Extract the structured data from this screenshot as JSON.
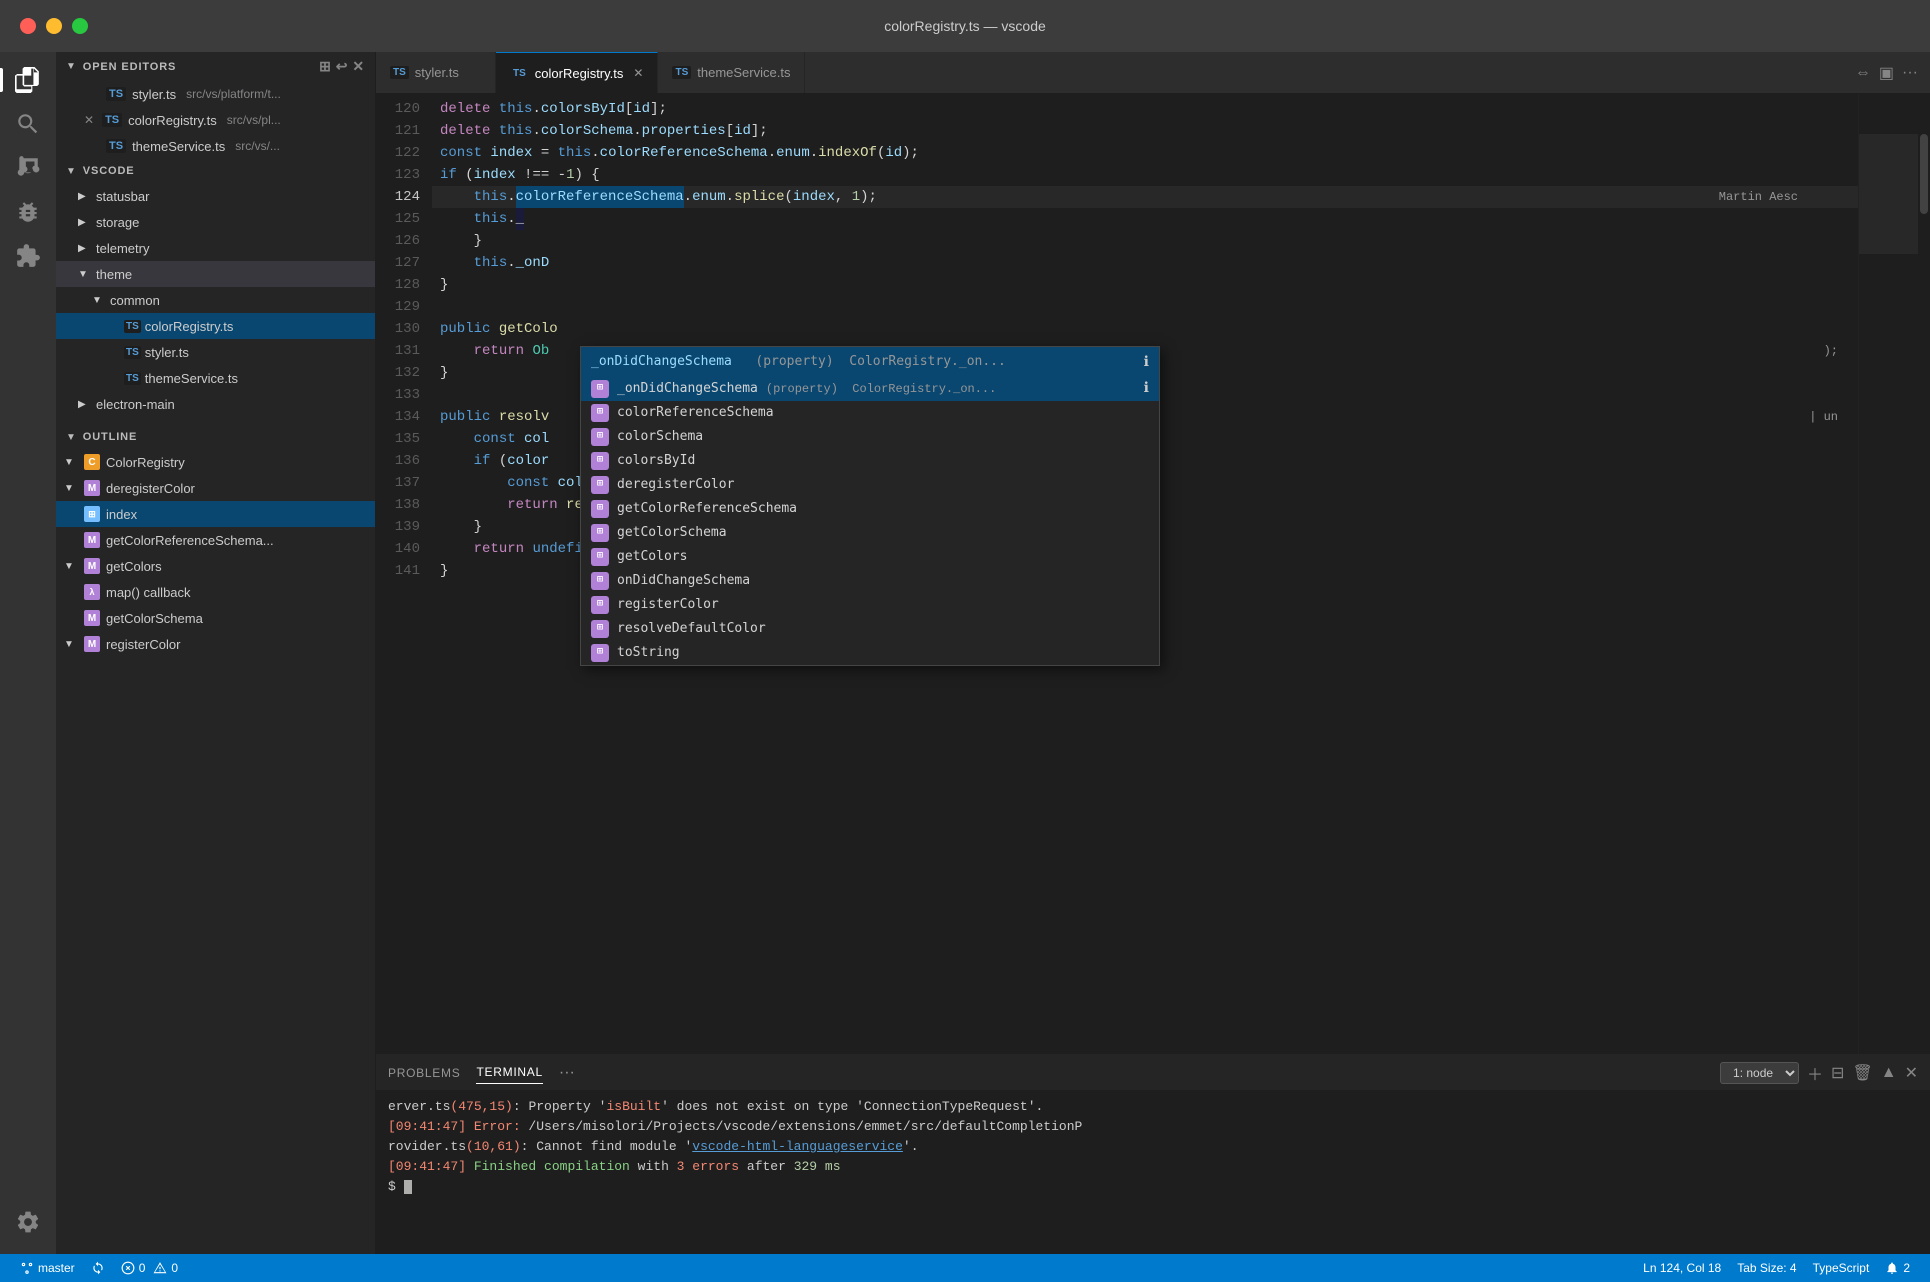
{
  "titlebar": {
    "title": "colorRegistry.ts — vscode"
  },
  "tabs": [
    {
      "id": "styler",
      "icon": "TS",
      "label": "styler.ts",
      "active": false,
      "closeable": false
    },
    {
      "id": "colorRegistry",
      "icon": "TS",
      "label": "colorRegistry.ts",
      "active": true,
      "closeable": true
    },
    {
      "id": "themeService",
      "icon": "TS",
      "label": "themeService.ts",
      "active": false,
      "closeable": false
    }
  ],
  "sidebar": {
    "open_editors_label": "OPEN EDITORS",
    "vscode_label": "VSCODE",
    "outline_label": "OUTLINE",
    "open_files": [
      {
        "icon": "TS",
        "name": "styler.ts",
        "path": "src/vs/platform/t..."
      },
      {
        "icon": "TS",
        "name": "colorRegistry.ts",
        "path": "src/vs/pl...",
        "active": true,
        "close": true
      },
      {
        "icon": "TS",
        "name": "themeService.ts",
        "path": "src/vs/..."
      }
    ],
    "tree": [
      {
        "indent": 1,
        "chevron": "▶",
        "label": "statusbar"
      },
      {
        "indent": 1,
        "chevron": "▶",
        "label": "storage"
      },
      {
        "indent": 1,
        "chevron": "▶",
        "label": "telemetry"
      },
      {
        "indent": 1,
        "chevron": "▼",
        "label": "theme",
        "active": true
      },
      {
        "indent": 2,
        "chevron": "▼",
        "label": "common"
      },
      {
        "indent": 3,
        "chevron": "",
        "label": "colorRegistry.ts",
        "file": true,
        "selected": true
      },
      {
        "indent": 3,
        "chevron": "",
        "label": "styler.ts",
        "file": true
      },
      {
        "indent": 3,
        "chevron": "",
        "label": "themeService.ts",
        "file": true
      },
      {
        "indent": 1,
        "chevron": "▶",
        "label": "electron-main"
      }
    ],
    "outline": [
      {
        "indent": 1,
        "chevron": "▼",
        "icon": "class",
        "label": "ColorRegistry"
      },
      {
        "indent": 2,
        "chevron": "▼",
        "icon": "method",
        "label": "deregisterColor"
      },
      {
        "indent": 3,
        "chevron": "",
        "icon": "field",
        "label": "index"
      },
      {
        "indent": 2,
        "chevron": "",
        "icon": "method",
        "label": "getColorReferenceSchema..."
      },
      {
        "indent": 2,
        "chevron": "▼",
        "icon": "method",
        "label": "getColors"
      },
      {
        "indent": 3,
        "chevron": "",
        "icon": "field",
        "label": "map() callback"
      },
      {
        "indent": 3,
        "chevron": "",
        "icon": "field",
        "label": "getColorSchema"
      },
      {
        "indent": 2,
        "chevron": "▼",
        "icon": "method",
        "label": "registerColor"
      }
    ]
  },
  "code": {
    "lines": [
      {
        "num": 120,
        "content": "        delete this.colorsById[id];"
      },
      {
        "num": 121,
        "content": "        delete this.colorSchema.properties[id];"
      },
      {
        "num": 122,
        "content": "        const index = this.colorReferenceSchema.enum.indexOf(id);"
      },
      {
        "num": 123,
        "content": "        if (index !== -1) {"
      },
      {
        "num": 124,
        "content": "            this.colorReferenceSchema.enum.splice(index, 1);",
        "highlight": true
      },
      {
        "num": 125,
        "content": "            this._"
      },
      {
        "num": 126,
        "content": "        }"
      },
      {
        "num": 127,
        "content": "        this._onD"
      },
      {
        "num": 128,
        "content": "    }"
      },
      {
        "num": 129,
        "content": ""
      },
      {
        "num": 130,
        "content": "    public getColo"
      },
      {
        "num": 131,
        "content": "        return Ob"
      },
      {
        "num": 132,
        "content": "    }"
      },
      {
        "num": 133,
        "content": ""
      },
      {
        "num": 134,
        "content": "    public resolv"
      },
      {
        "num": 135,
        "content": "        const col"
      },
      {
        "num": 136,
        "content": "        if (color"
      },
      {
        "num": 137,
        "content": "            const colorValue = colorDesc.defaults[theme.type];"
      },
      {
        "num": 138,
        "content": "            return resolveColorValue(colorValue, theme);"
      },
      {
        "num": 139,
        "content": "        }"
      },
      {
        "num": 140,
        "content": "        return undefined;"
      },
      {
        "num": 141,
        "content": "    }"
      }
    ]
  },
  "autocomplete": {
    "header": "_onDidChangeSchema    (property)  ColorRegistry._on...",
    "info_icon": "ℹ",
    "items": [
      {
        "label": "_onDidChangeSchema",
        "type": "property",
        "detail": "ColorRegistry._on...",
        "selected": true
      },
      {
        "label": "colorReferenceSchema",
        "type": "field"
      },
      {
        "label": "colorSchema",
        "type": "field"
      },
      {
        "label": "colorsById",
        "type": "field"
      },
      {
        "label": "deregisterColor",
        "type": "method"
      },
      {
        "label": "getColorReferenceSchema",
        "type": "method"
      },
      {
        "label": "getColorSchema",
        "type": "method"
      },
      {
        "label": "getColors",
        "type": "method"
      },
      {
        "label": "onDidChangeSchema",
        "type": "method"
      },
      {
        "label": "registerColor",
        "type": "method"
      },
      {
        "label": "resolveDefaultColor",
        "type": "method"
      },
      {
        "label": "toString",
        "type": "method"
      }
    ]
  },
  "terminal": {
    "tabs": [
      "PROBLEMS",
      "TERMINAL",
      "..."
    ],
    "active_tab": "TERMINAL",
    "node_option": "1: node",
    "lines": [
      "erver.ts(475,15): Property 'isBuilt' does not exist on type 'ConnectionTypeRequest'.",
      "[09:41:47] Error: /Users/misolori/Projects/vscode/extensions/emmet/src/defaultCompletionP",
      "rovider.ts(10,61): Cannot find module 'vscode-html-languageservice'.",
      "[09:41:47] Finished compilation with 3 errors after 329 ms"
    ]
  },
  "status_bar": {
    "branch": "master",
    "errors": "0",
    "warnings": "0",
    "position": "Ln 124, Col 18",
    "tab_size": "Tab Size: 4",
    "language": "TypeScript",
    "bell": "2"
  }
}
